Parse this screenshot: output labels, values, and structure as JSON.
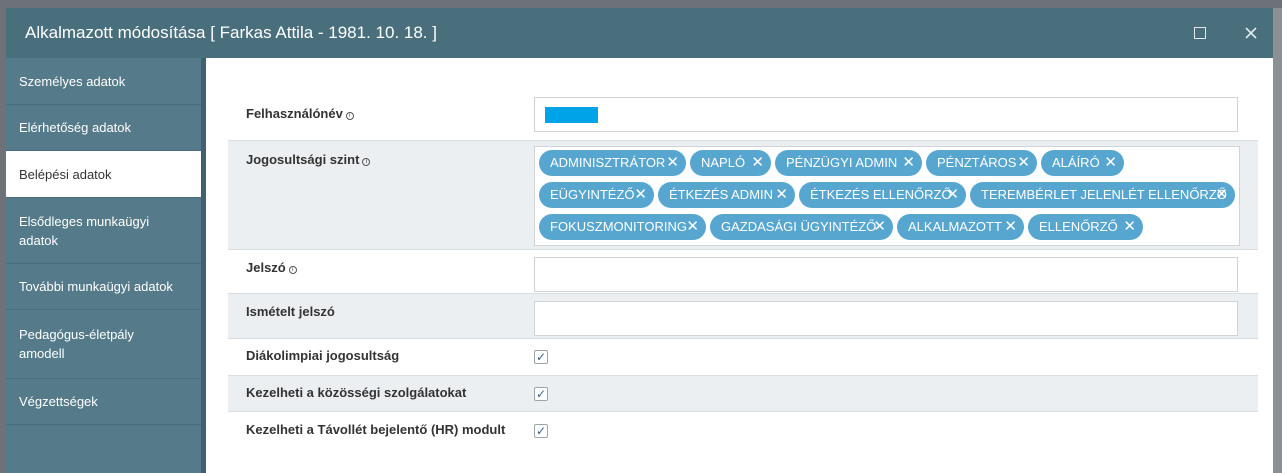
{
  "window": {
    "title": "Alkalmazott módosítása [ Farkas Attila - 1981. 10. 18. ]",
    "maximize_icon": "square-outline-icon",
    "close_icon": "close-x-icon",
    "titlebar_color": "#496f7d"
  },
  "sidebar": {
    "items": [
      {
        "label": "Személyes adatok"
      },
      {
        "label": "Elérhetőség adatok"
      },
      {
        "label": "Belépési adatok"
      },
      {
        "label": "Elsődleges munkaügyi adatok"
      },
      {
        "label": "További munkaügyi adatok"
      },
      {
        "label": "Pedagógus-életpályamodell"
      },
      {
        "label": "Végzettségek"
      }
    ],
    "active_index": 2,
    "color": "#557a89"
  },
  "form": {
    "username_label": "Felhasználónév",
    "access_level_label": "Jogosultsági szint",
    "password_label": "Jelszó",
    "password_repeat_label": "Ismételt jelszó",
    "diakolimpia_label": "Diákolimpiai jogosultság",
    "kozossegi_label": "Kezelheti a közösségi szolgálatokat",
    "tavollet_label": "Kezelheti a Távollét bejelentő (HR) modult",
    "diakolimpia_checked": true,
    "kozossegi_checked": true,
    "tavollet_checked": true,
    "tags": [
      "ADMINISZTRÁTOR",
      "NAPLÓ",
      "PÉNZÜGYI ADMIN",
      "PÉNZTÁROS",
      "ALÁÍRÓ",
      "EÜGYINTÉZŐ",
      "ÉTKEZÉS ADMIN",
      "ÉTKEZÉS ELLENŐRZŐ",
      "TEREMBÉRLET JELENLÉT ELLENŐRZŐ",
      "FOKUSZMONITORING",
      "GAZDASÁGI ÜGYINTÉZŐ",
      "ALKALMAZOTT",
      "ELLENŐRZŐ"
    ],
    "tag_color": "#57a6d0",
    "check_mark": "✓",
    "tag_remove": "✕"
  }
}
